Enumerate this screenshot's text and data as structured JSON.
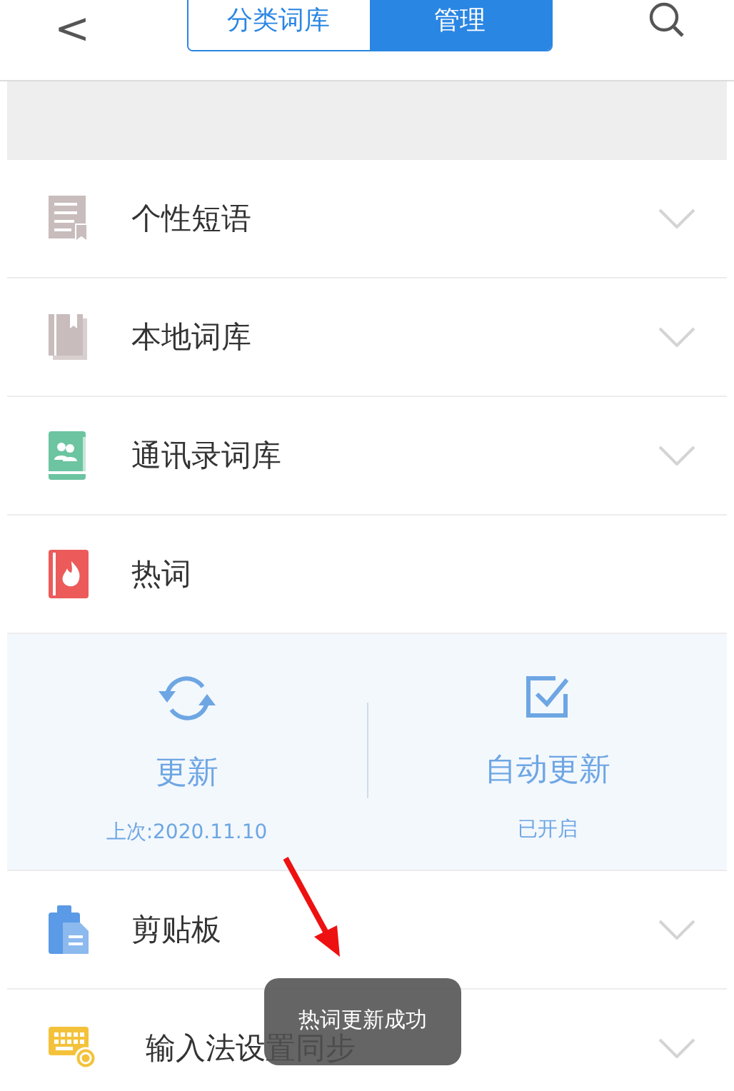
{
  "header": {
    "back": "<",
    "tabs": [
      {
        "label": "分类词库",
        "selected": false
      },
      {
        "label": "管理",
        "selected": true
      }
    ]
  },
  "items": [
    {
      "kind": "category",
      "label": "个性短语",
      "expanded": false
    },
    {
      "kind": "category",
      "label": "本地词库",
      "expanded": false
    },
    {
      "kind": "category",
      "label": "通讯录词库",
      "expanded": false
    },
    {
      "kind": "hot",
      "label": "热词",
      "actions": [
        {
          "label": "更新",
          "note": "上次:2020.11.10"
        },
        {
          "label": "自动更新",
          "note": "已开启"
        }
      ]
    },
    {
      "kind": "category",
      "label": "剪贴板",
      "expanded": false
    },
    {
      "kind": "category",
      "label": "输入法设置同步",
      "expanded": false
    }
  ],
  "toast": "热词更新成功"
}
